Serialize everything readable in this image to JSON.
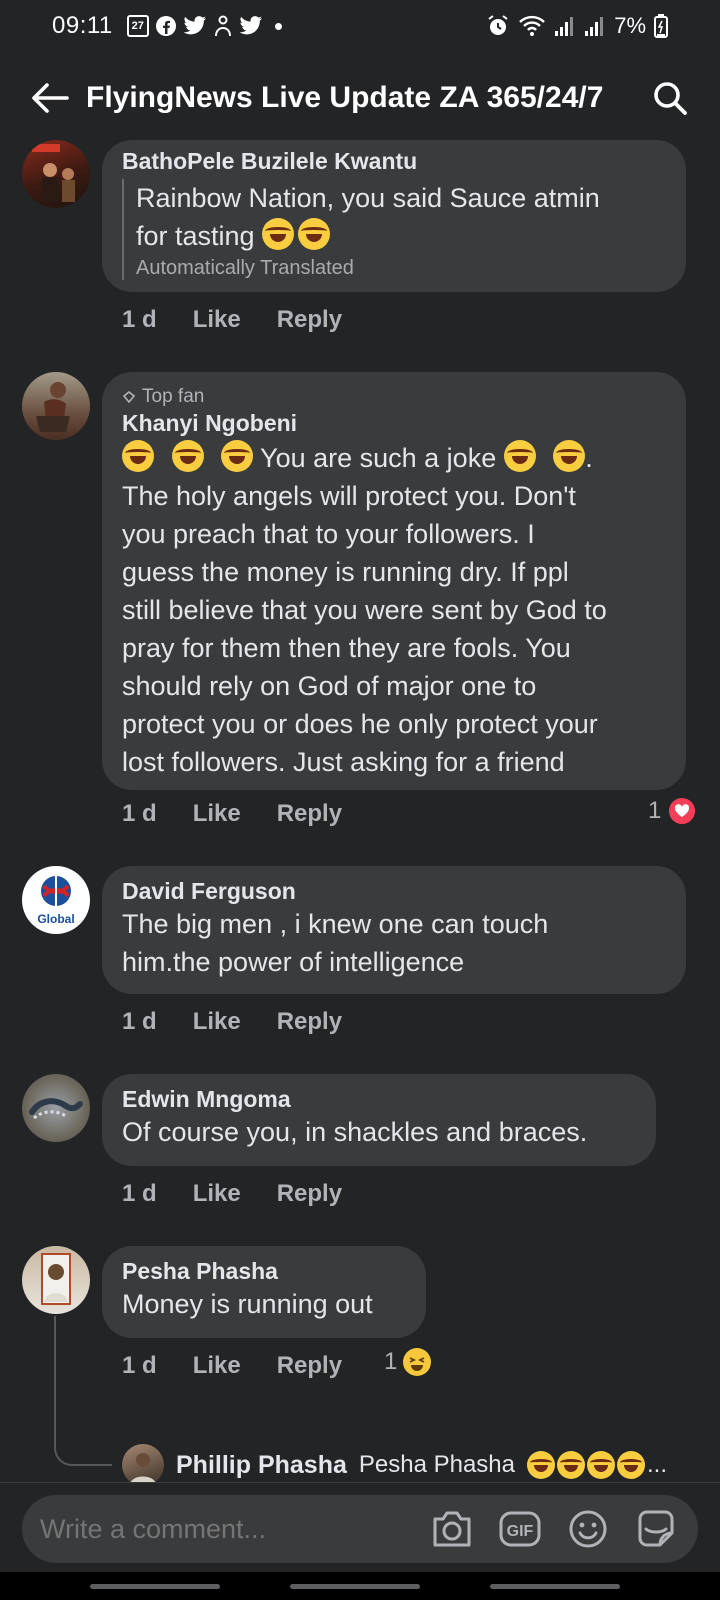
{
  "status_bar": {
    "time": "09:11",
    "battery": "7%",
    "left_icons": [
      "calendar-icon",
      "facebook-icon",
      "twitter-icon",
      "app-icon",
      "twitter-icon",
      "dot-icon"
    ],
    "calendar_day": "27",
    "right_icons": [
      "alarm-icon",
      "wifi-icon",
      "signal-icon",
      "signal-icon",
      "battery-icon"
    ]
  },
  "header": {
    "title": "FlyingNews Live Update ZA 365/24/7"
  },
  "comments": [
    {
      "author": "BathoPele Buzilele Kwantu",
      "text_line1": "Rainbow Nation, you said Sauce atmin",
      "text_line2": "for tasting",
      "translation_note": "Automatically Translated",
      "time": "1 d",
      "like": "Like",
      "reply": "Reply"
    },
    {
      "badge": "Top fan",
      "author": "Khanyi Ngobeni",
      "text_line1_mid": "You are such a joke",
      "text_line1_end": ".",
      "text_rest": [
        "The holy angels will protect you. Don't",
        "you preach that to your followers. I",
        "guess the money is running dry. If ppl",
        "still believe that you were sent by God to",
        "pray for them then they are fools. You",
        "should rely on God of major one to",
        "protect you or does he only protect your",
        "lost followers. Just asking for a friend"
      ],
      "time": "1 d",
      "like": "Like",
      "reply": "Reply",
      "reaction_count": "1"
    },
    {
      "author": "David Ferguson",
      "avatar_text": "Global",
      "text_lines": [
        "The big men , i knew one can touch",
        "him.the power of intelligence"
      ],
      "time": "1 d",
      "like": "Like",
      "reply": "Reply"
    },
    {
      "author": "Edwin Mngoma",
      "text_lines": [
        "Of course you, in shackles and braces."
      ],
      "time": "1 d",
      "like": "Like",
      "reply": "Reply"
    },
    {
      "author": "Pesha Phasha",
      "text_lines": [
        "Money is running out"
      ],
      "time": "1 d",
      "like": "Like",
      "reply": "Reply",
      "reaction_count": "1"
    }
  ],
  "reply_preview": {
    "author": "Phillip Phasha",
    "text": "Pesha Phasha",
    "ellipsis": "..."
  },
  "composer": {
    "placeholder": "Write a comment...",
    "icons": [
      "camera-icon",
      "gif-icon",
      "emoji-icon",
      "sticker-icon"
    ],
    "gif_label": "GIF"
  },
  "colors": {
    "background": "#232426",
    "bubble": "#3a3b3c",
    "heart": "#f33e58",
    "laugh": "#f7c83b"
  }
}
